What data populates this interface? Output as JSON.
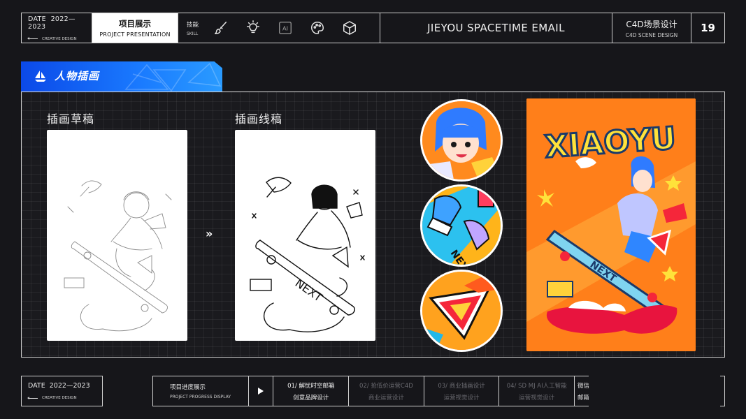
{
  "header": {
    "date_label": "DATE",
    "date_range": "2022—2023",
    "creative_design": "CREATIVE DESIGN",
    "project_cn": "项目展示",
    "project_en": "PROJECT PRESENTATION",
    "skill_cn": "技能",
    "skill_en": "SKILL",
    "tools": [
      "brush-icon",
      "bulb-icon",
      "ai-icon",
      "palette-icon",
      "cube-icon"
    ],
    "ai_text": "AI",
    "title": "JIEYOU SPACETIME EMAIL",
    "c4d_cn": "C4D场景设计",
    "c4d_en": "C4D SCENE DESIGN",
    "page_number": "19"
  },
  "section": {
    "label": "人物插画"
  },
  "panel": {
    "draft_title": "插画草稿",
    "lineart_title": "插画线稿",
    "arrow": "»",
    "poster_text": "XIAOYU",
    "board_text": "NEXT"
  },
  "footer": {
    "date_label": "DATE",
    "date_range": "2022—2023",
    "creative_design": "CREATIVE DESIGN",
    "progress_cn": "项目进度展示",
    "progress_en": "PROJECT PROGRESS DISPLAY",
    "steps": [
      {
        "line1": "01/ 解忧时空邮箱",
        "line2": "创意品牌设计"
      },
      {
        "line1": "02/ 抢低价运营C4D",
        "line2": "商业运营设计"
      },
      {
        "line1": "03/ 商业插画设计",
        "line2": "运营视觉设计"
      },
      {
        "line1": "04/ SD MJ AI人工智能",
        "line2": "运营视觉设计"
      }
    ],
    "tail_line1": "微信",
    "tail_line2": "邮箱"
  },
  "colors": {
    "background": "#16161a",
    "accent_blue": "#1a6dff",
    "poster_orange": "#ff7f1a"
  }
}
